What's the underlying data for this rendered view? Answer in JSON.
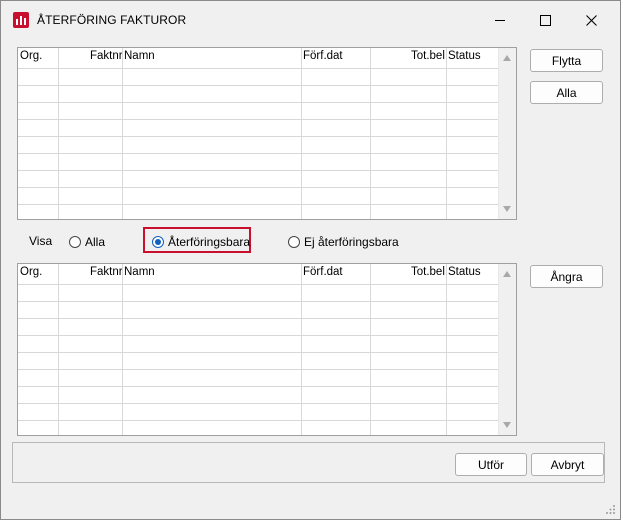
{
  "window": {
    "title": "ÅTERFÖRING FAKTUROR",
    "controls": [
      "minimize-icon",
      "maximize-icon",
      "close-icon"
    ]
  },
  "top_table": {
    "columns": [
      "Org.",
      "Faktnr",
      "Namn",
      "Förf.dat",
      "Tot.bel",
      "Status"
    ],
    "rows": []
  },
  "side_buttons": {
    "move": "Flytta",
    "all": "Alla",
    "undo": "Ångra"
  },
  "filter": {
    "label": "Visa",
    "options": [
      "Alla",
      "Återföringsbara",
      "Ej återföringsbara"
    ],
    "selected": "Återföringsbara"
  },
  "bottom_table": {
    "columns": [
      "Org.",
      "Faktnr",
      "Namn",
      "Förf.dat",
      "Tot.bel",
      "Status"
    ],
    "rows": []
  },
  "footer": {
    "execute": "Utför",
    "cancel": "Avbryt"
  },
  "colors": {
    "accent": "#c8102e",
    "radio_selected": "#1060c0"
  }
}
